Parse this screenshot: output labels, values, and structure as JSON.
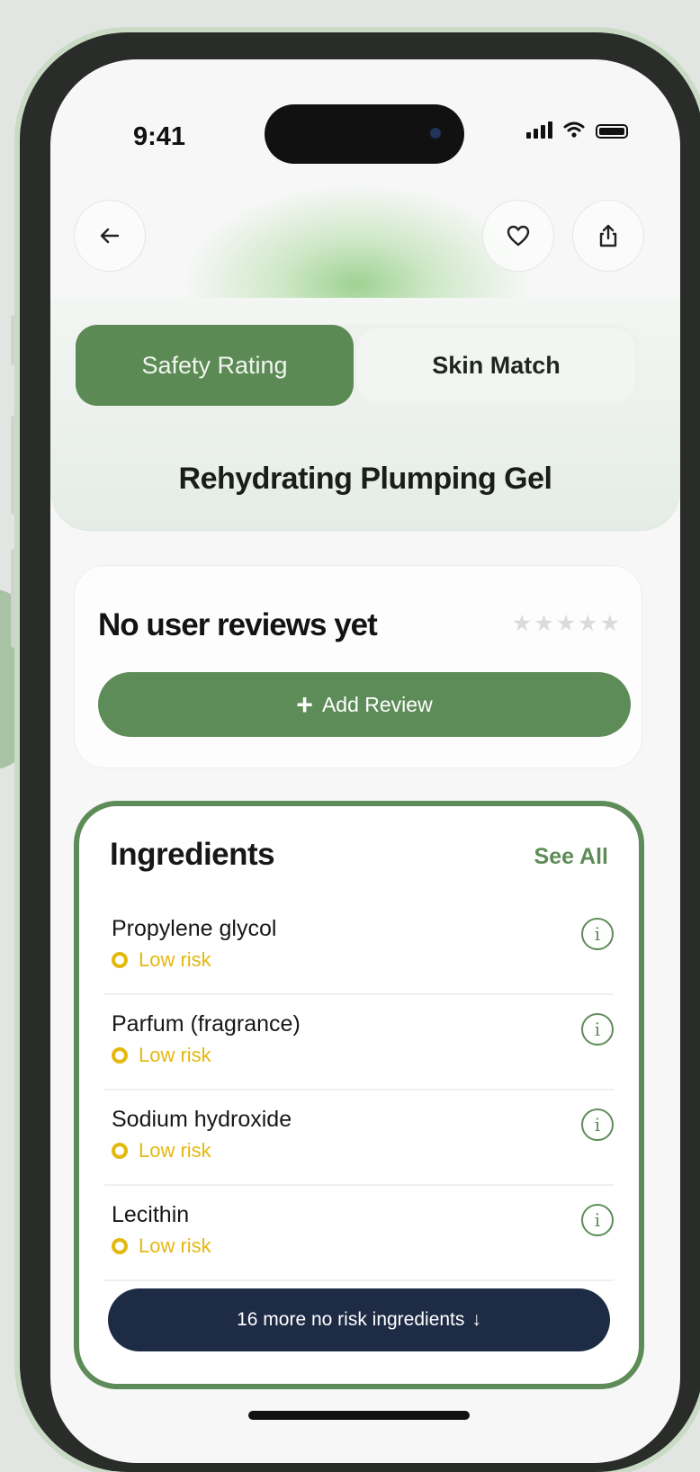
{
  "status_bar": {
    "time": "9:41"
  },
  "tabs": [
    {
      "label": "Safety Rating",
      "active": true
    },
    {
      "label": "Skin Match",
      "active": false
    }
  ],
  "product": {
    "name": "Rehydrating Plumping Gel"
  },
  "reviews": {
    "title": "No user reviews yet",
    "rating": 0,
    "max_rating": 5,
    "add_label": "Add Review"
  },
  "ingredients": {
    "title": "Ingredients",
    "see_all_label": "See All",
    "items": [
      {
        "name": "Propylene glycol",
        "risk": "Low risk"
      },
      {
        "name": "Parfum (fragrance)",
        "risk": "Low risk"
      },
      {
        "name": "Sodium hydroxide",
        "risk": "Low risk"
      },
      {
        "name": "Lecithin",
        "risk": "Low risk"
      }
    ],
    "more_label": "16 more no risk ingredients",
    "more_arrow": "↓"
  },
  "colors": {
    "accent": "#5e8c58",
    "risk_low": "#e3b80f",
    "dark_button": "#1e2b45"
  }
}
